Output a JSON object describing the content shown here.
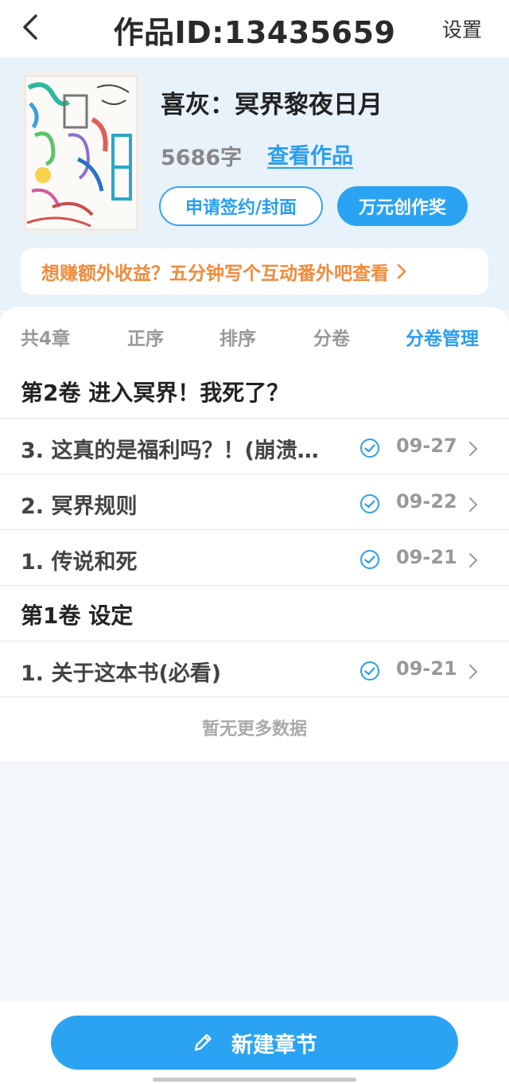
{
  "header": {
    "back_icon": "chevron-left-icon",
    "title": "作品ID:13435659",
    "settings_label": "设置"
  },
  "book": {
    "title": "喜灰：冥界黎夜日月",
    "word_count": "5686字",
    "view_label": "查看作品",
    "sign_button": "申请签约/封面",
    "award_button": "万元创作奖",
    "promo_text": "想赚额外收益？五分钟写个互动番外吧查看"
  },
  "tabs": {
    "count": "共4章",
    "order": "正序",
    "sort": "排序",
    "volume": "分卷",
    "volume_manage": "分卷管理"
  },
  "volumes": [
    {
      "title": "第2卷 进入冥界！我死了？",
      "chapters": [
        {
          "title": "3. 这真的是福利吗？！(崩溃…",
          "date": "09-27"
        },
        {
          "title": "2. 冥界规则",
          "date": "09-22"
        },
        {
          "title": "1. 传说和死",
          "date": "09-21"
        }
      ]
    },
    {
      "title": "第1卷 设定",
      "chapters": [
        {
          "title": "1. 关于这本书(必看)",
          "date": "09-21"
        }
      ]
    }
  ],
  "footer_note": "暂无更多数据",
  "new_chapter_label": "新建章节",
  "colors": {
    "accent": "#2ba3f3",
    "promo": "#f28a3a",
    "header_bg": "#e8f2fb"
  }
}
